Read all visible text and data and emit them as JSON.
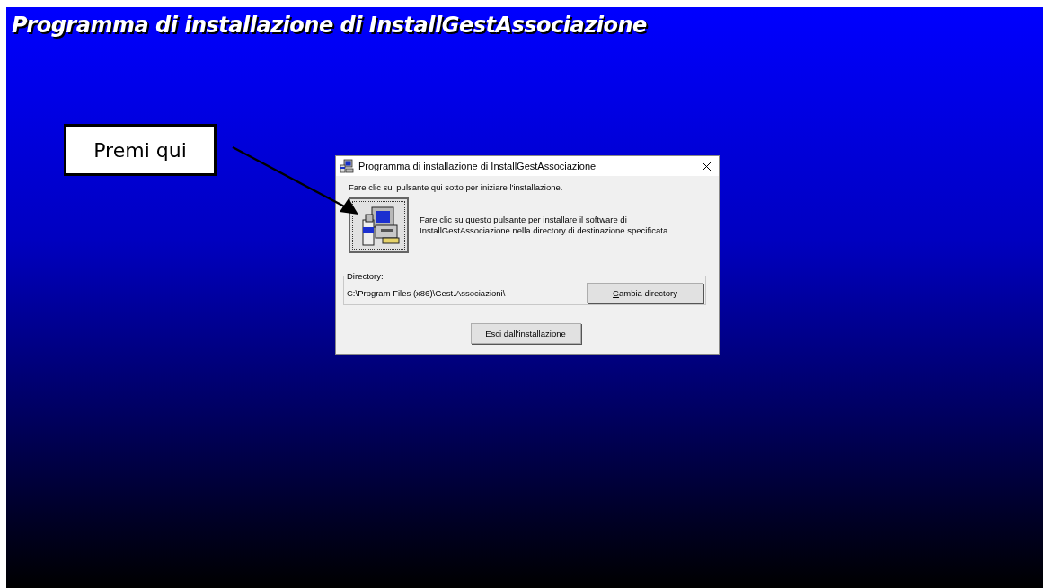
{
  "banner": {
    "title": "Programma di installazione di InstallGestAssociazione"
  },
  "callout": {
    "text": "Premi qui"
  },
  "dialog": {
    "title": "Programma di installazione di InstallGestAssociazione",
    "intro": "Fare clic sul pulsante qui sotto per iniziare l'installazione.",
    "install_text": "Fare clic su questo pulsante per installare il software di InstallGestAssociazione nella directory di destinazione specificata.",
    "directory_label": "Directory:",
    "directory_path": "C:\\Program Files (x86)\\Gest.Associazioni\\",
    "change_button": "Cambia directory",
    "exit_button": "Esci dall'installazione"
  }
}
